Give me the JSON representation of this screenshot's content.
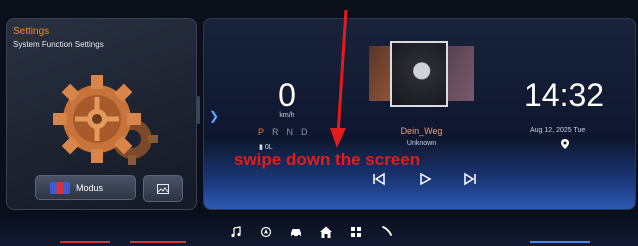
{
  "left_panel": {
    "title": "Settings",
    "subtitle": "System Function Settings",
    "modus_label": "Modus",
    "accent": "#f08a2a"
  },
  "cluster": {
    "speed": "0",
    "unit": "km/h",
    "gear_letters": [
      "P",
      "R",
      "N",
      "D"
    ],
    "active_gear": "P",
    "fuel": "0L"
  },
  "media": {
    "song": "Dein_Weg",
    "artist": "Unknown"
  },
  "clock": {
    "time": "14:32",
    "date": "Aug 12, 2025 Tue"
  },
  "annotation": {
    "text": "swipe down the screen",
    "color": "#e21b1b"
  },
  "dock": {
    "icons": [
      "music-icon",
      "navigation-icon",
      "car-icon",
      "home-icon",
      "apps-icon",
      "phone-icon"
    ]
  }
}
